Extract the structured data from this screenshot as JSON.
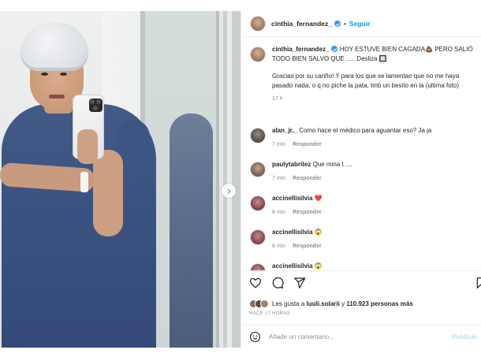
{
  "post": {
    "username": "cinthia_fernandez_",
    "follow_label": "Seguir",
    "separator": "•"
  },
  "caption": {
    "username": "cinthia_fernandez_",
    "line1": "HOY ESTUVE BIEN CAGADA💩 PERO SALIÓ TODO BIEN SALVO QUE ..... Desliza 🔲",
    "line2": "Gracias por su cariño! Y para los que se lamentan que no me haya pasado nada, o q no piche la pata, tmb un besito en la (ultima foto)",
    "age": "17 h"
  },
  "comments": [
    {
      "user": "alan_jr._",
      "text": "Como hace el médico para aguantar eso? Ja ja",
      "time": "7 min",
      "reply": "Responder"
    },
    {
      "user": "paulytabritez",
      "text": "Que mina t ....",
      "time": "7 min",
      "reply": "Responder"
    },
    {
      "user": "accinellisilvia",
      "text": "❤️",
      "time": "8 min",
      "reply": "Responder"
    },
    {
      "user": "accinellisilvia",
      "text": "😱",
      "time": "8 min",
      "reply": "Responder"
    },
    {
      "user": "accinellisilvia",
      "text": "😱",
      "time": "",
      "reply": ""
    }
  ],
  "likes": {
    "prefix": "Les gusta a",
    "user": "luuli.solarii",
    "middle": "y",
    "count": "110.923 personas más"
  },
  "timestamp": "HACE 17 HORAS",
  "comment_box": {
    "placeholder": "Añade un comentario...",
    "post_label": "Publicar"
  },
  "carousel": {
    "slides": 3,
    "active": 1
  },
  "colors": {
    "accent": "#0095f6",
    "verified": "#3897f0",
    "heart": "#e0245e"
  },
  "icons": [
    "heart-icon",
    "comment-icon",
    "share-icon",
    "save-icon",
    "emoji-icon",
    "chevron-right-icon",
    "verified-icon"
  ]
}
